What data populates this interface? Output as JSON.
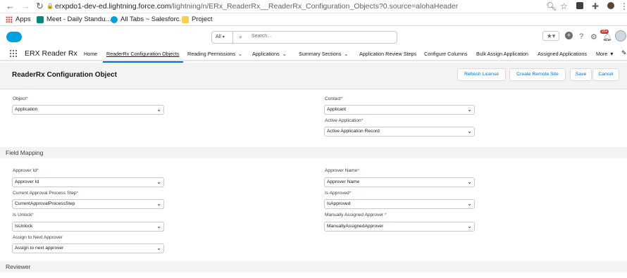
{
  "browser": {
    "back": "←",
    "forward": "→",
    "reload": "↻",
    "lock": "🔒",
    "url_host": "erxpdo1-dev-ed.lightning.force.com",
    "url_path": "/lightning/n/ERx_ReaderRx__ReaderRx_Configuration_Objects?0.source=alohaHeader",
    "bookmarks": [
      {
        "label": "Apps",
        "color": "#ea4335"
      },
      {
        "label": "Meet - Daily Standu...",
        "color": "#00897b"
      },
      {
        "label": "All Tabs ~ Salesforc...",
        "color": "#00a1e0"
      },
      {
        "label": "Project",
        "color": "#f9ce4a"
      }
    ]
  },
  "header": {
    "search_scope": "All",
    "search_placeholder": "Search...",
    "notification_count": "20+"
  },
  "app": {
    "name": "ERX Reader Rx",
    "nav": [
      {
        "label": "Home",
        "dropdown": false
      },
      {
        "label": "ReaderRx Configuration Objects",
        "dropdown": false,
        "active": true
      },
      {
        "label": "Reading Permissions",
        "dropdown": true
      },
      {
        "label": "Applications",
        "dropdown": true
      },
      {
        "label": "Summary Sections",
        "dropdown": true
      },
      {
        "label": "Application Review Steps",
        "dropdown": false
      },
      {
        "label": "Configure Columns",
        "dropdown": false
      },
      {
        "label": "Bulk Assign Application",
        "dropdown": false
      },
      {
        "label": "Assigned Applications",
        "dropdown": false
      },
      {
        "label": "More",
        "dropdown": true
      }
    ]
  },
  "page": {
    "title": "ReaderRx Configuration Object",
    "buttons": {
      "refresh": "Refresh License",
      "create": "Create Remote Site",
      "save": "Save",
      "cancel": "Cancel"
    }
  },
  "form": {
    "object": {
      "label": "Object",
      "value": "Application"
    },
    "contact": {
      "label": "Contact",
      "value": "Applicant"
    },
    "active_application": {
      "label": "Active Application",
      "value": "Active Application Record"
    },
    "field_mapping_title": "Field Mapping",
    "approver_id": {
      "label": "Approver Id",
      "value": "Approver Id"
    },
    "approver_name": {
      "label": "Approver Name",
      "value": "Approver Name"
    },
    "current_step": {
      "label": "Current Approval Process Step",
      "value": "CurrentApprovalProcessStep"
    },
    "is_approved": {
      "label": "Is Approved",
      "value": "IsApproved"
    },
    "is_unlock": {
      "label": "Is Unlock",
      "value": "IsUnlock"
    },
    "manually_assigned": {
      "label": "Manually Assigned Approver ",
      "value": "ManuallyAssignedApprover"
    },
    "assign_next": {
      "label": "Assign to Next Approver",
      "value": "Assign to next approver"
    },
    "reviewer_title": "Reviewer"
  }
}
